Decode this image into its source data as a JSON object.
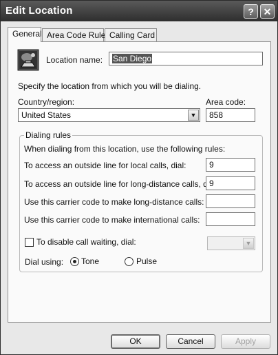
{
  "window": {
    "title": "Edit Location",
    "help_button": "?",
    "close_button": "✕"
  },
  "tabs": [
    {
      "label": "General",
      "active": true
    },
    {
      "label": "Area Code Rules",
      "active": false
    },
    {
      "label": "Calling Card",
      "active": false
    }
  ],
  "general": {
    "location_name_label": "Location name:",
    "location_name_value": "San Diego",
    "specify_text": "Specify the location from which you will be dialing.",
    "country_label": "Country/region:",
    "country_value": "United States",
    "area_code_label": "Area code:",
    "area_code_value": "858"
  },
  "dialing_rules": {
    "group_label": "Dialing rules",
    "intro": "When dialing from this location, use the following rules:",
    "local_label": "To access an outside line for local calls, dial:",
    "local_value": "9",
    "long_distance_label": "To access an outside line for long-distance calls, dial:",
    "long_distance_value": "9",
    "carrier_long_label": "Use this carrier code to make long-distance calls:",
    "carrier_long_value": "",
    "carrier_intl_label": "Use this carrier code to make international calls:",
    "carrier_intl_value": ""
  },
  "call_waiting": {
    "label": "To disable call waiting, dial:",
    "checked": false,
    "value": ""
  },
  "dial_using": {
    "label": "Dial using:",
    "tone_label": "Tone",
    "pulse_label": "Pulse",
    "selected": "Tone"
  },
  "buttons": {
    "ok": "OK",
    "cancel": "Cancel",
    "apply": "Apply"
  },
  "icons": {
    "location": "location-phone-icon",
    "dropdown": "chevron-down-icon",
    "help": "help-icon",
    "close": "close-icon"
  }
}
